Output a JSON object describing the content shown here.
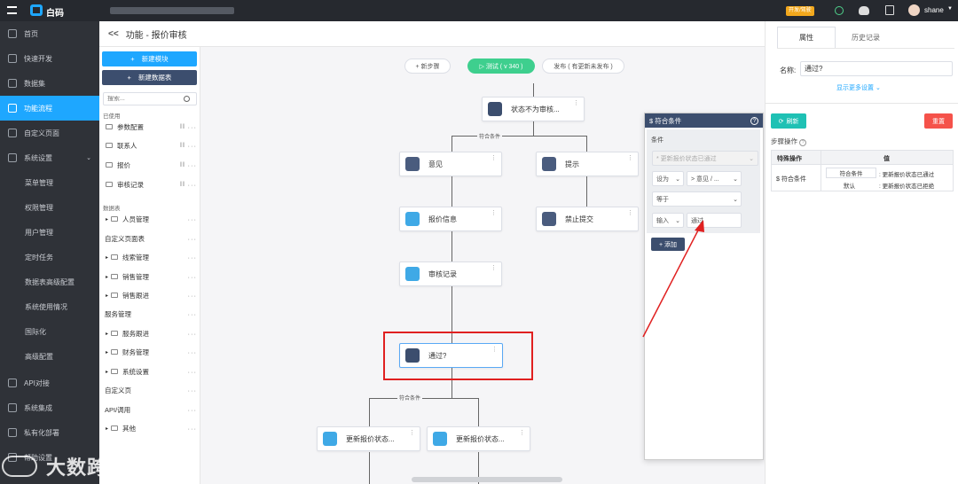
{
  "app": {
    "brand": "白码"
  },
  "topbar": {
    "badge": "开发/驾驶",
    "user": "shane"
  },
  "sidebar": {
    "items": [
      {
        "label": "首页"
      },
      {
        "label": "快速开发"
      },
      {
        "label": "数据集"
      },
      {
        "label": "功能流程",
        "active": true
      },
      {
        "label": "自定义页面"
      },
      {
        "label": "系统设置"
      },
      {
        "label": "菜单管理"
      },
      {
        "label": "权限管理"
      },
      {
        "label": "用户管理"
      },
      {
        "label": "定时任务"
      },
      {
        "label": "数据表高级配置"
      },
      {
        "label": "系统使用情况"
      },
      {
        "label": "国际化"
      },
      {
        "label": "高级配置"
      },
      {
        "label": "API对接"
      },
      {
        "label": "系统集成"
      },
      {
        "label": "私有化部署"
      },
      {
        "label": "帮助设置"
      }
    ]
  },
  "header": {
    "back": "<<",
    "title": "功能 - 报价审核"
  },
  "modules": {
    "new_module": "新建模块",
    "new_table": "新建数据表",
    "search_placeholder": "搜索...",
    "used_label": "已使用",
    "used": [
      "参数配置",
      "联系人",
      "报价",
      "审核记录"
    ],
    "tables_label": "数据表",
    "tables": [
      "人员管理",
      "自定义页面表",
      "线索管理",
      "销售管理",
      "销售跟进",
      "服务管理",
      "服务跟进",
      "财务管理",
      "系统设置",
      "自定义页",
      "API/调用",
      "其他"
    ]
  },
  "toolbar": {
    "add_step": "+ 新步骤",
    "test": "▷ 测试 ( v 340 )",
    "publish": "发布 ( 有更新未发布 )"
  },
  "flow": {
    "nodes": [
      "状态不为审核...",
      "意见",
      "提示",
      "报价信息",
      "禁止提交",
      "审核记录",
      "通过?",
      "更新报价状态...",
      "更新报价状态..."
    ],
    "edge_labels": [
      "符合条件",
      "符合条件"
    ]
  },
  "cond_popup": {
    "title": "$ 符合条件",
    "section": "条件",
    "placeholder": "* 更新报价状态已通过",
    "set_label": "设为",
    "set_value": "> 意见 / ...",
    "op": "等于",
    "input_label": "输入",
    "input_value": "通过",
    "add": "+ 添加"
  },
  "rpanel": {
    "tab_attr": "属性",
    "tab_history": "历史记录",
    "name_label": "名称:",
    "name_value": "通过?",
    "more": "显示更多设置",
    "refresh": "刷新",
    "reset": "重置",
    "step_ops": "步骤操作",
    "col_special": "特殊操作",
    "col_value": "值",
    "row_label": "$ 符合条件",
    "row_a": "符合条件",
    "row_a_val": ": 更新报价状态已通过",
    "row_b": "默认",
    "row_b_val": ": 更新报价状态已拒绝"
  },
  "watermark": "大数跨境",
  "colors": {
    "accent": "#1ea7ff",
    "test": "#3ecf8e",
    "danger": "#f5524a",
    "teal": "#1fc1b4",
    "navy": "#3c4e6e",
    "highlight": "#e02020"
  }
}
